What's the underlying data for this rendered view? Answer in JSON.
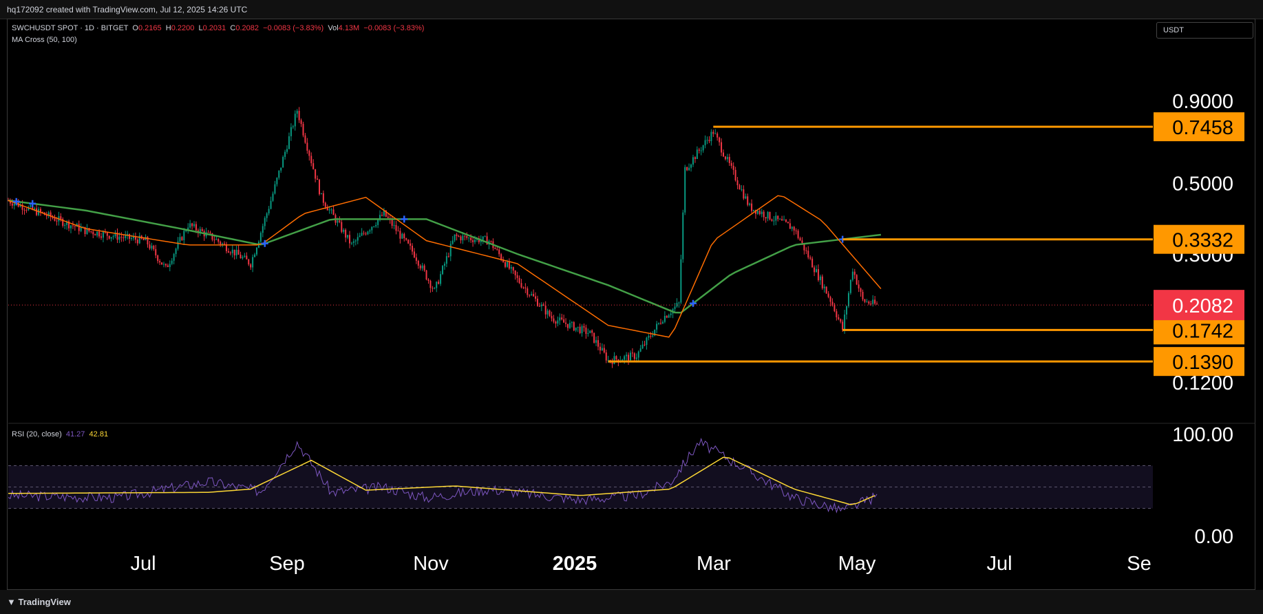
{
  "header": {
    "credit": "hq172092 created with TradingView.com, Jul 12, 2025 14:26 UTC"
  },
  "legend": {
    "symbol": "SWCHUSDT SPOT · 1D · BITGET",
    "open_label": "O",
    "open": "0.2165",
    "high_label": "H",
    "high": "0.2200",
    "low_label": "L",
    "low": "0.2031",
    "close_label": "C",
    "close": "0.2082",
    "change": "−0.0083 (−3.83%)",
    "vol_label": "Vol",
    "vol": "4.13M",
    "vol_change": "−0.0083 (−3.83%)",
    "indicator": "MA Cross (50, 100)",
    "rsi_label": "RSI (20, close)",
    "rsi_value": "41.27",
    "rsi_ma_value": "42.81"
  },
  "currency_button": "USDT",
  "footer": {
    "brand": "TradingView"
  },
  "colors": {
    "up": "#089981",
    "down": "#f23645",
    "ma_fast": "#ff6d00",
    "ma_slow": "#43a047",
    "level": "#ff9800",
    "cross": "#2962ff",
    "rsi": "#7e57c2",
    "rsi_ma": "#fdd835"
  },
  "chart_data": {
    "type": "candlestick",
    "scale": "log",
    "price_axis_labels": [
      "0.9000",
      "0.5000",
      "0.3000",
      "0.1200"
    ],
    "time_axis_labels": [
      "Jul",
      "Sep",
      "Nov",
      "2025",
      "Mar",
      "May",
      "Jul",
      "Se"
    ],
    "horizontal_levels": [
      {
        "value": 0.7458,
        "label": "0.7458"
      },
      {
        "value": 0.3332,
        "label": "0.3332"
      },
      {
        "value": 0.1742,
        "label": "0.1742"
      },
      {
        "value": 0.139,
        "label": "0.1390"
      }
    ],
    "last_price": {
      "value": 0.2082,
      "label": "0.2082"
    },
    "price_path": [
      [
        "2024-05-08",
        0.44
      ],
      [
        "2024-05-25",
        0.4
      ],
      [
        "2024-06-15",
        0.355
      ],
      [
        "2024-07-01",
        0.34
      ],
      [
        "2024-07-15",
        0.33
      ],
      [
        "2024-07-25",
        0.27
      ],
      [
        "2024-08-05",
        0.37
      ],
      [
        "2024-08-18",
        0.335
      ],
      [
        "2024-09-05",
        0.28
      ],
      [
        "2024-09-15",
        0.44
      ],
      [
        "2024-09-28",
        0.84
      ],
      [
        "2024-10-10",
        0.45
      ],
      [
        "2024-10-25",
        0.32
      ],
      [
        "2024-11-10",
        0.4
      ],
      [
        "2024-11-25",
        0.3
      ],
      [
        "2024-12-05",
        0.23
      ],
      [
        "2024-12-15",
        0.34
      ],
      [
        "2025-01-01",
        0.33
      ],
      [
        "2025-01-15",
        0.25
      ],
      [
        "2025-02-01",
        0.19
      ],
      [
        "2025-02-20",
        0.17
      ],
      [
        "2025-03-01",
        0.14
      ],
      [
        "2025-03-15",
        0.145
      ],
      [
        "2025-03-28",
        0.19
      ],
      [
        "2025-04-05",
        0.21
      ],
      [
        "2025-04-08",
        0.55
      ],
      [
        "2025-04-22",
        0.72
      ],
      [
        "2025-05-10",
        0.42
      ],
      [
        "2025-06-01",
        0.36
      ],
      [
        "2025-06-20",
        0.21
      ],
      [
        "2025-06-25",
        0.175
      ],
      [
        "2025-06-30",
        0.27
      ],
      [
        "2025-07-05",
        0.215
      ],
      [
        "2025-07-12",
        0.2082
      ]
    ],
    "ma50_path": [
      [
        "2024-05-08",
        0.44
      ],
      [
        "2024-06-15",
        0.36
      ],
      [
        "2024-08-05",
        0.32
      ],
      [
        "2024-09-10",
        0.32
      ],
      [
        "2024-10-01",
        0.4
      ],
      [
        "2024-11-01",
        0.45
      ],
      [
        "2024-12-01",
        0.33
      ],
      [
        "2025-01-15",
        0.28
      ],
      [
        "2025-03-01",
        0.18
      ],
      [
        "2025-04-01",
        0.165
      ],
      [
        "2025-04-22",
        0.33
      ],
      [
        "2025-05-25",
        0.46
      ],
      [
        "2025-06-15",
        0.38
      ],
      [
        "2025-07-15",
        0.23
      ]
    ],
    "ma100_path": [
      [
        "2024-05-08",
        0.44
      ],
      [
        "2024-06-15",
        0.41
      ],
      [
        "2024-08-01",
        0.36
      ],
      [
        "2024-09-10",
        0.32
      ],
      [
        "2024-10-15",
        0.385
      ],
      [
        "2024-12-01",
        0.385
      ],
      [
        "2025-01-15",
        0.3
      ],
      [
        "2025-03-01",
        0.24
      ],
      [
        "2025-04-05",
        0.195
      ],
      [
        "2025-05-01",
        0.26
      ],
      [
        "2025-06-01",
        0.32
      ],
      [
        "2025-07-15",
        0.345
      ]
    ],
    "ma_crosses": [
      "2024-05-12",
      "2024-05-20",
      "2024-09-12",
      "2024-11-20",
      "2025-04-12",
      "2025-06-25"
    ],
    "rsi": {
      "axis_labels": [
        "100.00",
        "0.00"
      ],
      "bands": [
        70,
        50,
        30
      ],
      "path": [
        [
          "2024-05-08",
          42
        ],
        [
          "2024-07-01",
          40
        ],
        [
          "2024-08-15",
          55
        ],
        [
          "2024-09-10",
          46
        ],
        [
          "2024-09-28",
          92
        ],
        [
          "2024-10-15",
          45
        ],
        [
          "2024-11-10",
          50
        ],
        [
          "2024-12-01",
          40
        ],
        [
          "2025-01-01",
          48
        ],
        [
          "2025-02-15",
          38
        ],
        [
          "2025-03-15",
          42
        ],
        [
          "2025-04-01",
          55
        ],
        [
          "2025-04-15",
          92
        ],
        [
          "2025-05-01",
          75
        ],
        [
          "2025-06-01",
          40
        ],
        [
          "2025-06-25",
          28
        ],
        [
          "2025-07-12",
          41.27
        ]
      ],
      "ma_path": [
        [
          "2024-05-08",
          44
        ],
        [
          "2024-08-15",
          45
        ],
        [
          "2024-09-05",
          48
        ],
        [
          "2024-10-05",
          75
        ],
        [
          "2024-11-01",
          47
        ],
        [
          "2024-12-15",
          51
        ],
        [
          "2025-02-15",
          42
        ],
        [
          "2025-04-01",
          48
        ],
        [
          "2025-04-28",
          79
        ],
        [
          "2025-06-01",
          48
        ],
        [
          "2025-06-30",
          33
        ],
        [
          "2025-07-12",
          42.81
        ]
      ]
    }
  }
}
